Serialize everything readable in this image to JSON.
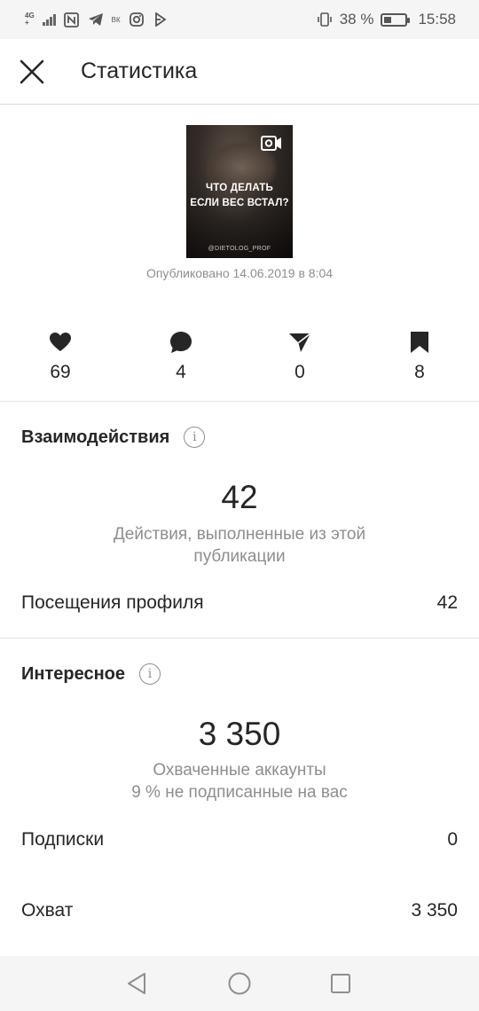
{
  "status_bar": {
    "network": "4G",
    "network_sub": "+",
    "battery_text": "38 %",
    "battery_level": 0.38,
    "time": "15:58",
    "icons": [
      "signal-icon",
      "nfc-icon",
      "telegram-icon",
      "vk-icon",
      "instagram-icon",
      "flash-icon",
      "vibrate-icon",
      "battery-icon"
    ]
  },
  "header": {
    "title": "Статистика",
    "close_icon": "close-icon"
  },
  "post": {
    "thumbnail_line1": "ЧТО ДЕЛАТЬ",
    "thumbnail_line2": "ЕСЛИ ВЕС ВСТАЛ?",
    "thumbnail_handle": "@DIETOLOG_PROF",
    "media_icon": "video-icon",
    "published": "Опубликовано 14.06.2019 в 8:04"
  },
  "metrics": [
    {
      "icon": "heart-icon",
      "value": "69"
    },
    {
      "icon": "comment-icon",
      "value": "4"
    },
    {
      "icon": "send-icon",
      "value": "0"
    },
    {
      "icon": "bookmark-icon",
      "value": "8"
    }
  ],
  "interactions": {
    "title": "Взаимодействия",
    "value": "42",
    "description": "Действия, выполненные из этой публикации",
    "rows": [
      {
        "label": "Посещения профиля",
        "value": "42"
      }
    ]
  },
  "discovery": {
    "title": "Интересное",
    "value": "3 350",
    "description_line1": "Охваченные аккаунты",
    "description_line2": "9 % не подписанные на вас",
    "rows": [
      {
        "label": "Подписки",
        "value": "0"
      },
      {
        "label": "Охват",
        "value": "3 350"
      }
    ]
  },
  "nav_bar": {
    "icons": [
      "back-icon",
      "home-icon",
      "recents-icon"
    ]
  },
  "colors": {
    "text": "#262626",
    "secondary": "#8e8e8e",
    "divider": "#e3e3e3",
    "system_bar": "#f5f5f5"
  }
}
